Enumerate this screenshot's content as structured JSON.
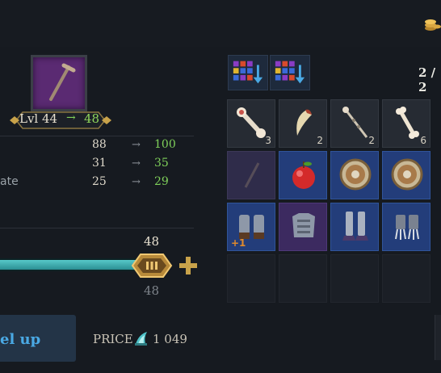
{
  "item": {
    "icon": "nail-icon",
    "frame_color": "#5a2a72"
  },
  "level": {
    "current": "Lvl 44",
    "arrow": "→",
    "next": "48"
  },
  "stats": [
    {
      "label": "",
      "old": "88",
      "arrow": "→",
      "new": "100"
    },
    {
      "label": "",
      "old": "31",
      "arrow": "→",
      "new": "35"
    },
    {
      "label": "ate",
      "old": "25",
      "arrow": "→",
      "new": "29"
    }
  ],
  "slider": {
    "value_top": "48",
    "value_bottom": "48",
    "plus": "+",
    "fill_fraction": 1.0
  },
  "levelup": {
    "label": "el up"
  },
  "price": {
    "label": "PRICE",
    "value": "1 049"
  },
  "inventory": {
    "slot_count": "2 / 2",
    "filter_icons": [
      "sort-down-icon",
      "sort-down-icon"
    ],
    "slots": [
      {
        "icon": "bone-joint-icon",
        "qty": "3",
        "bg": "gray"
      },
      {
        "icon": "fang-icon",
        "qty": "2",
        "bg": "gray"
      },
      {
        "icon": "bone-spike-icon",
        "qty": "2",
        "bg": "gray"
      },
      {
        "icon": "bone-icon",
        "qty": "6",
        "bg": "gray"
      },
      {
        "icon": "nail-icon",
        "qty": "",
        "bg": "dim"
      },
      {
        "icon": "apple-icon",
        "qty": "",
        "bg": "blue"
      },
      {
        "icon": "round-shield-icon",
        "qty": "",
        "bg": "blue"
      },
      {
        "icon": "round-shield-icon",
        "qty": "",
        "bg": "blue"
      },
      {
        "icon": "gauntlets-icon",
        "qty": "",
        "bg": "blue",
        "badge": "+1"
      },
      {
        "icon": "chest-armor-icon",
        "qty": "",
        "bg": "purple"
      },
      {
        "icon": "greaves-icon",
        "qty": "",
        "bg": "blue"
      },
      {
        "icon": "claw-gloves-icon",
        "qty": "",
        "bg": "blue"
      }
    ]
  },
  "colors": {
    "accent_green": "#7fd05a",
    "slider_teal": "#3fb4b6",
    "gold": "#c8a24a",
    "button_blue": "#4aa9e4"
  }
}
